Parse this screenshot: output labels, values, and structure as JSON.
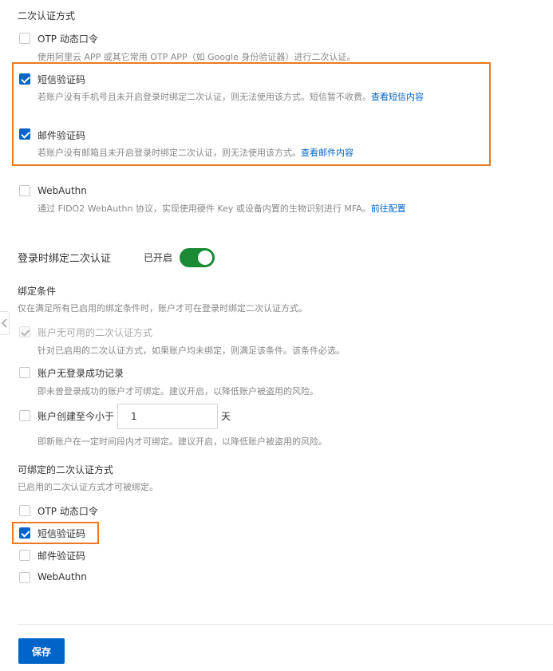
{
  "mfa_section": {
    "title": "二次认证方式",
    "options": [
      {
        "label": "OTP 动态口令",
        "checked": false,
        "desc": "使用阿里云 APP 或其它常用 OTP APP（如 Google 身份验证器）进行二次认证。"
      },
      {
        "label": "短信验证码",
        "checked": true,
        "desc": "若账户没有手机号且未开启登录时绑定二次认证，则无法使用该方式。短信暂不收费。",
        "link": "查看短信内容"
      },
      {
        "label": "邮件验证码",
        "checked": true,
        "desc": "若账户没有邮箱且未开启登录时绑定二次认证，则无法使用该方式。",
        "link": "查看邮件内容"
      },
      {
        "label": "WebAuthn",
        "checked": false,
        "desc": "通过 FIDO2 WebAuthn 协议，实现使用硬件 Key 或设备内置的生物识别进行 MFA。",
        "link": "前往配置"
      }
    ]
  },
  "bind_on_login": {
    "label": "登录时绑定二次认证",
    "status": "已开启",
    "enabled": true
  },
  "bind_conditions": {
    "title": "绑定条件",
    "desc": "仅在满足所有已启用的绑定条件时，账户才可在登录时绑定二次认证方式。",
    "items": [
      {
        "label": "账户无可用的二次认证方式",
        "checked": true,
        "disabled": true,
        "desc": "针对已启用的二次认证方式，如果账户均未绑定，则满足该条件。该条件必选。"
      },
      {
        "label": "账户无登录成功记录",
        "checked": false,
        "desc": "即未曾登录成功的账户才可绑定。建议开启，以降低账户被盗用的风险。"
      },
      {
        "label": "账户创建至今小于",
        "checked": false,
        "value": "1",
        "unit": "天",
        "desc": "即新账户在一定时间段内才可绑定。建议开启，以降低账户被盗用的风险。"
      }
    ]
  },
  "bindable_methods": {
    "title": "可绑定的二次认证方式",
    "desc": "已启用的二次认证方式才可被绑定。",
    "items": [
      {
        "label": "OTP 动态口令",
        "checked": false
      },
      {
        "label": "短信验证码",
        "checked": true
      },
      {
        "label": "邮件验证码",
        "checked": false
      },
      {
        "label": "WebAuthn",
        "checked": false
      }
    ]
  },
  "save_label": "保存",
  "colors": {
    "primary": "#0064c8",
    "highlight": "#ec7a24",
    "toggle_on": "#1a8a34"
  }
}
